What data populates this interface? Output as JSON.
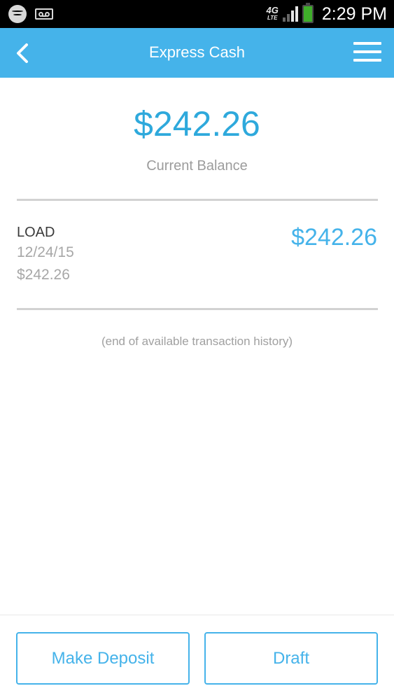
{
  "status_bar": {
    "time": "2:29 PM",
    "network_label": "4G",
    "network_sub": "LTE",
    "icons": [
      "spotify-icon",
      "voicemail-icon",
      "4g-lte-icon",
      "signal-icon",
      "battery-icon"
    ],
    "battery_color": "#3fae2a"
  },
  "app_bar": {
    "title": "Express Cash",
    "background": "#45b3ea",
    "back_icon": "chevron-left-icon",
    "menu_icon": "hamburger-menu-icon"
  },
  "balance": {
    "amount": "$242.26",
    "label": "Current Balance",
    "color": "#2ea9dc"
  },
  "transactions": [
    {
      "type": "LOAD",
      "date": "12/24/15",
      "sub_amount": "$242.26",
      "amount": "$242.26"
    }
  ],
  "end_note": "(end of available transaction history)",
  "actions": {
    "deposit_label": "Make Deposit",
    "draft_label": "Draft"
  }
}
